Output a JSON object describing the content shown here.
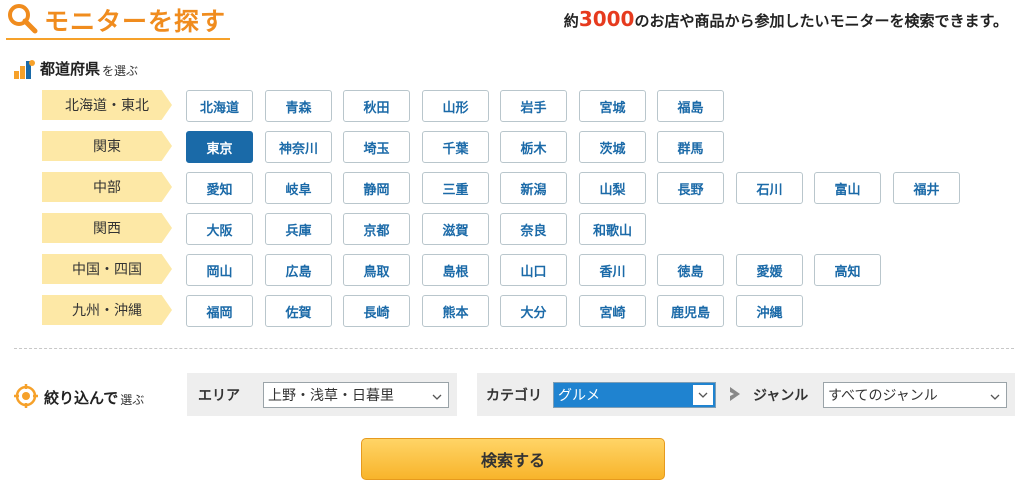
{
  "header": {
    "title": "モニターを探す",
    "tagline_prefix": "約",
    "tagline_count": "3000",
    "tagline_suffix": "のお店や商品から参加したいモニターを検索できます。"
  },
  "prefecture_section": {
    "heading_main": "都道府県",
    "heading_sub": "を選ぶ",
    "regions": [
      {
        "name": "北海道・東北",
        "prefectures": [
          "北海道",
          "青森",
          "秋田",
          "山形",
          "岩手",
          "宮城",
          "福島"
        ]
      },
      {
        "name": "関東",
        "prefectures": [
          "東京",
          "神奈川",
          "埼玉",
          "千葉",
          "栃木",
          "茨城",
          "群馬"
        ]
      },
      {
        "name": "中部",
        "prefectures": [
          "愛知",
          "岐阜",
          "静岡",
          "三重",
          "新潟",
          "山梨",
          "長野",
          "石川",
          "富山",
          "福井"
        ]
      },
      {
        "name": "関西",
        "prefectures": [
          "大阪",
          "兵庫",
          "京都",
          "滋賀",
          "奈良",
          "和歌山"
        ]
      },
      {
        "name": "中国・四国",
        "prefectures": [
          "岡山",
          "広島",
          "鳥取",
          "島根",
          "山口",
          "香川",
          "徳島",
          "愛媛",
          "高知"
        ]
      },
      {
        "name": "九州・沖縄",
        "prefectures": [
          "福岡",
          "佐賀",
          "長崎",
          "熊本",
          "大分",
          "宮崎",
          "鹿児島",
          "沖縄"
        ]
      }
    ],
    "selected": "東京"
  },
  "filter_section": {
    "heading_main": "絞り込んで",
    "heading_sub": "選ぶ",
    "area_label": "エリア",
    "area_value": "上野・浅草・日暮里",
    "category_label": "カテゴリ",
    "category_value": "グルメ",
    "genre_label": "ジャンル",
    "genre_value": "すべてのジャンル"
  },
  "search_button": "検索する",
  "colors": {
    "accent": "#f08c1e",
    "selected": "#1a6aa8",
    "region_bg": "#fde8a6",
    "button_gradient_top": "#ffd466",
    "button_gradient_bottom": "#f8b42b"
  }
}
